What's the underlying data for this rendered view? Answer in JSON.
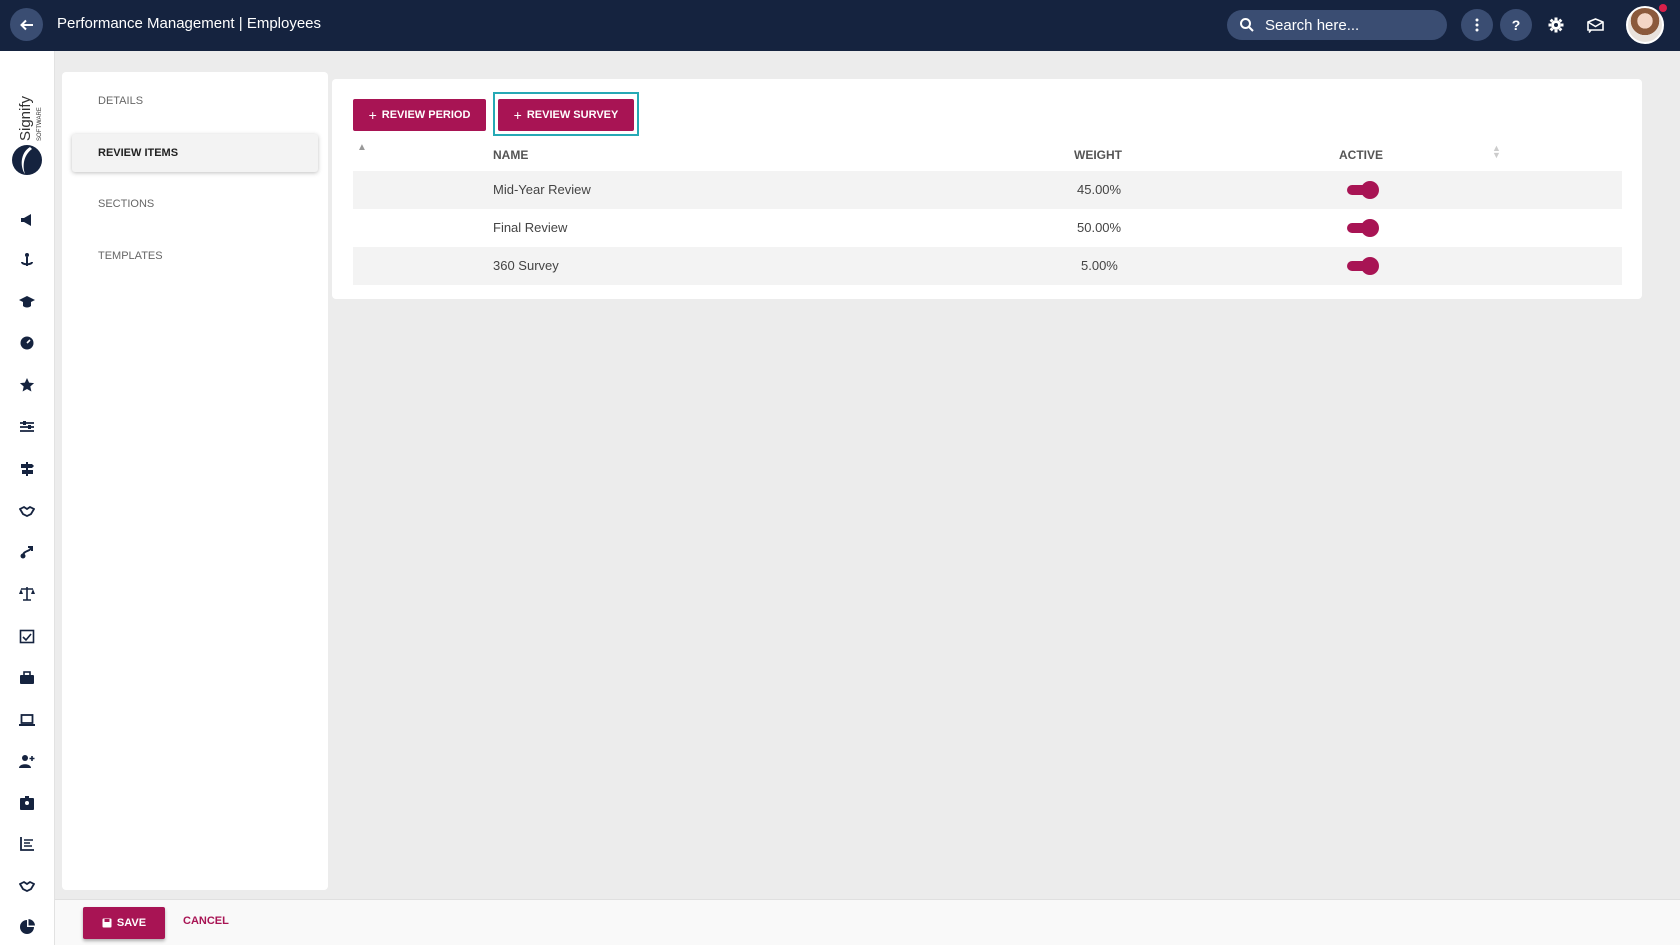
{
  "topbar": {
    "title": "Performance Management | Employees",
    "search_placeholder": "Search here...",
    "icons": [
      "back-arrow-icon",
      "search-icon",
      "more-vertical-icon",
      "help-icon",
      "gear-icon",
      "messages-icon",
      "avatar"
    ]
  },
  "logo": {
    "text": "Signify",
    "subtext": "SOFTWARE"
  },
  "rail": {
    "icons": [
      "megaphone-icon",
      "anchor-icon",
      "graduation-cap-icon",
      "gauge-icon",
      "star-icon",
      "sliders-icon",
      "signpost-icon",
      "handshake-icon",
      "route-icon",
      "scale-icon",
      "checklist-icon",
      "briefcase-icon",
      "laptop-icon",
      "add-user-icon",
      "id-badge-icon",
      "bar-chart-icon",
      "handshake-icon",
      "pie-chart-icon"
    ]
  },
  "sidenav": {
    "items": [
      {
        "label": "DETAILS"
      },
      {
        "label": "REVIEW ITEMS"
      },
      {
        "label": "SECTIONS"
      },
      {
        "label": "TEMPLATES"
      }
    ]
  },
  "actions": {
    "review_period": "REVIEW PERIOD",
    "review_survey": "REVIEW SURVEY"
  },
  "table": {
    "columns": {
      "name": "NAME",
      "weight": "WEIGHT",
      "active": "ACTIVE"
    },
    "rows": [
      {
        "name": "Mid-Year Review",
        "weight": "45.00%",
        "active": true
      },
      {
        "name": "Final Review",
        "weight": "50.00%",
        "active": true
      },
      {
        "name": "360 Survey",
        "weight": "5.00%",
        "active": true
      }
    ]
  },
  "footer": {
    "save": "SAVE",
    "cancel": "CANCEL"
  },
  "colors": {
    "topbar": "#15233f",
    "accent": "#a81454",
    "highlight": "#26a9b5"
  }
}
